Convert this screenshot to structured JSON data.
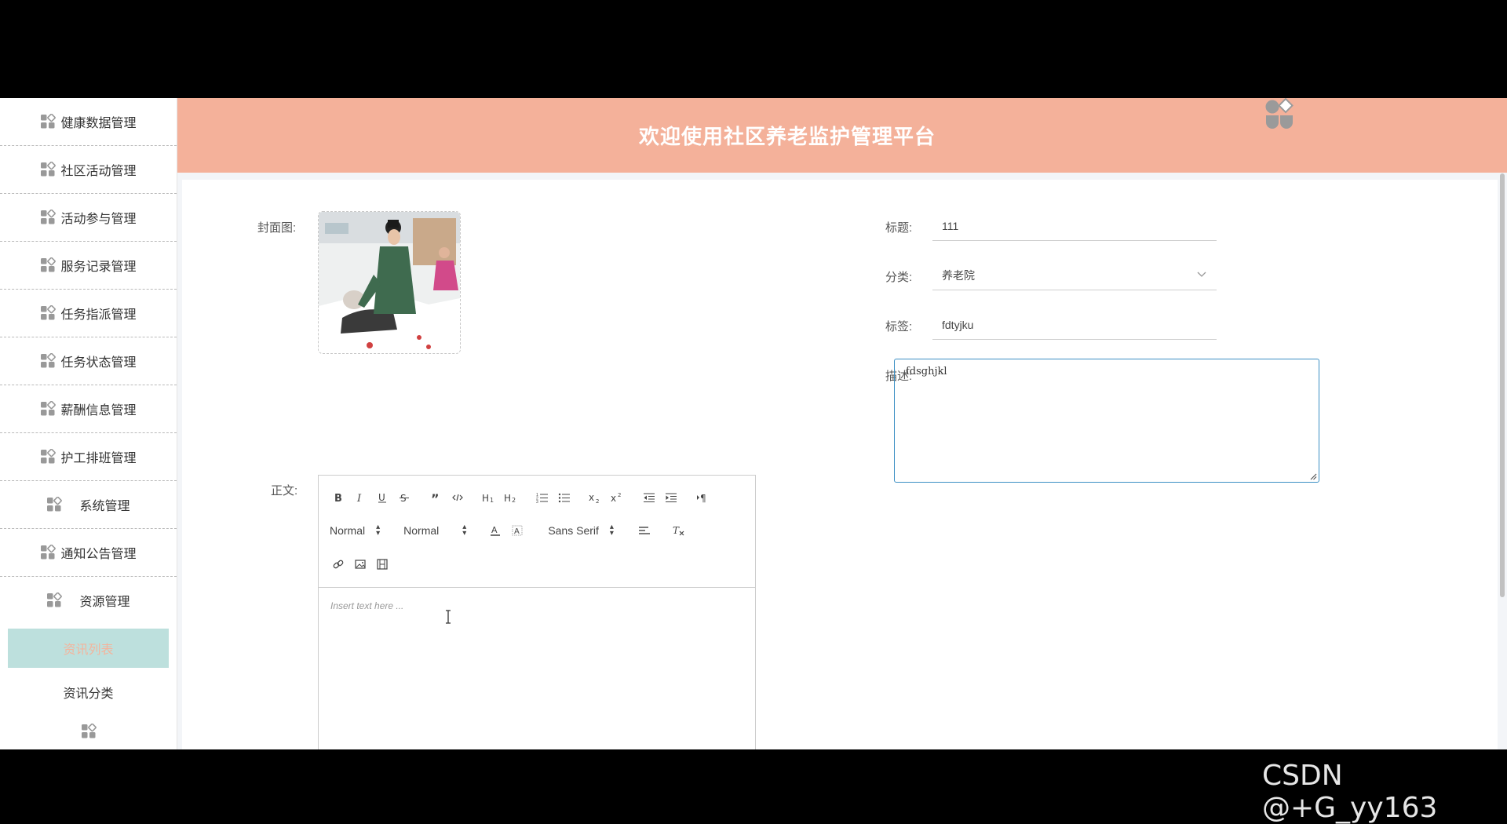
{
  "header": {
    "title": "欢迎使用社区养老监护管理平台"
  },
  "sidebar": {
    "items": [
      {
        "label": "健康数据管理"
      },
      {
        "label": "社区活动管理"
      },
      {
        "label": "活动参与管理"
      },
      {
        "label": "服务记录管理"
      },
      {
        "label": "任务指派管理"
      },
      {
        "label": "任务状态管理"
      },
      {
        "label": "薪酬信息管理"
      },
      {
        "label": "护工排班管理"
      },
      {
        "label": "系统管理"
      },
      {
        "label": "通知公告管理"
      },
      {
        "label": "资源管理"
      }
    ],
    "subitems": [
      {
        "label": "资讯列表",
        "active": true
      },
      {
        "label": "资讯分类",
        "active": false
      }
    ]
  },
  "form": {
    "cover_label": "封面图:",
    "title_label": "标题:",
    "title_value": "111",
    "category_label": "分类:",
    "category_value": "养老院",
    "tags_label": "标签:",
    "tags_value": "fdtyjku",
    "desc_label": "描述:",
    "desc_value": "fdsghjkl",
    "body_label": "正文:"
  },
  "editor": {
    "header_select": "Normal",
    "size_select": "Normal",
    "font_select": "Sans Serif",
    "placeholder": "Insert text here ..."
  },
  "watermark": "CSDN @+G_yy163",
  "colors": {
    "header_bg": "#f4b19a",
    "active_sub_bg": "#bde0dd",
    "active_sub_text": "#f4b49c",
    "focus_border": "#3b8fc4"
  }
}
